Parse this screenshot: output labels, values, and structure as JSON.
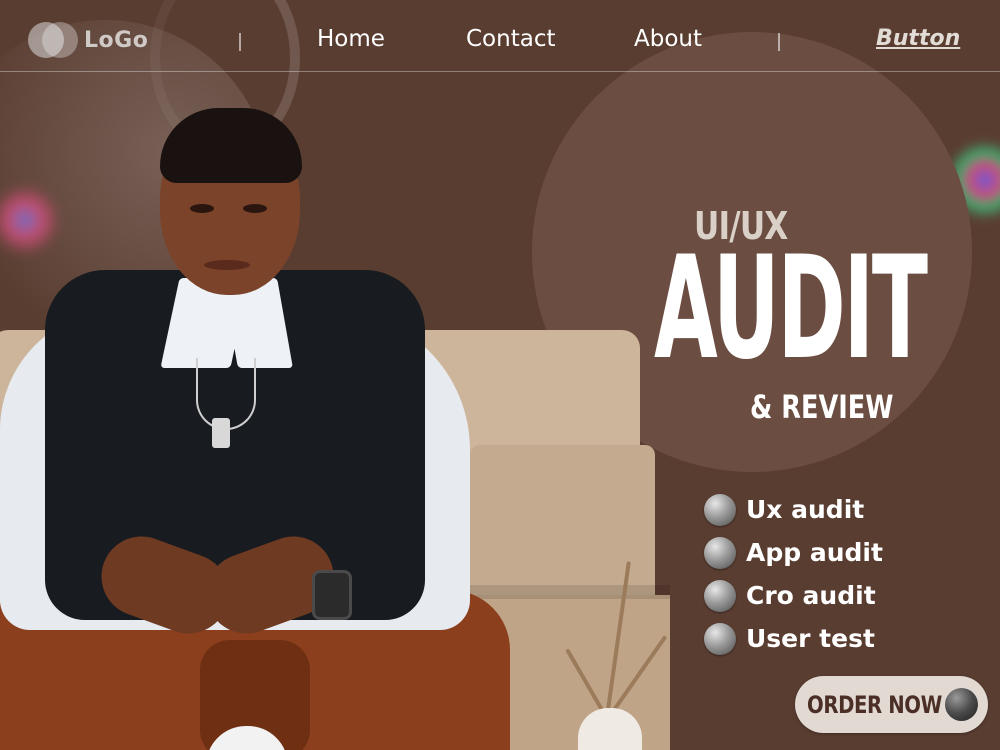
{
  "nav": {
    "logo_text": "LoGo",
    "links": [
      {
        "label": "Home"
      },
      {
        "label": "Contact"
      },
      {
        "label": "About"
      }
    ],
    "button_label": "Button"
  },
  "hero": {
    "pre_title": "UI/UX",
    "title": "AUDIT",
    "subtitle": "& REVIEW"
  },
  "services": [
    {
      "label": "Ux audit",
      "icon": "sphere-bullet-icon"
    },
    {
      "label": "App audit",
      "icon": "sphere-bullet-icon"
    },
    {
      "label": "Cro audit",
      "icon": "sphere-bullet-icon"
    },
    {
      "label": "User test",
      "icon": "sphere-bullet-icon"
    }
  ],
  "cta": {
    "label": "ORDER NOW",
    "icon": "sphere-icon"
  },
  "colors": {
    "background": "#5a3d31",
    "circle": "#6b4d41",
    "button_bg": "#e2dad2",
    "button_text": "#4b2f26"
  }
}
